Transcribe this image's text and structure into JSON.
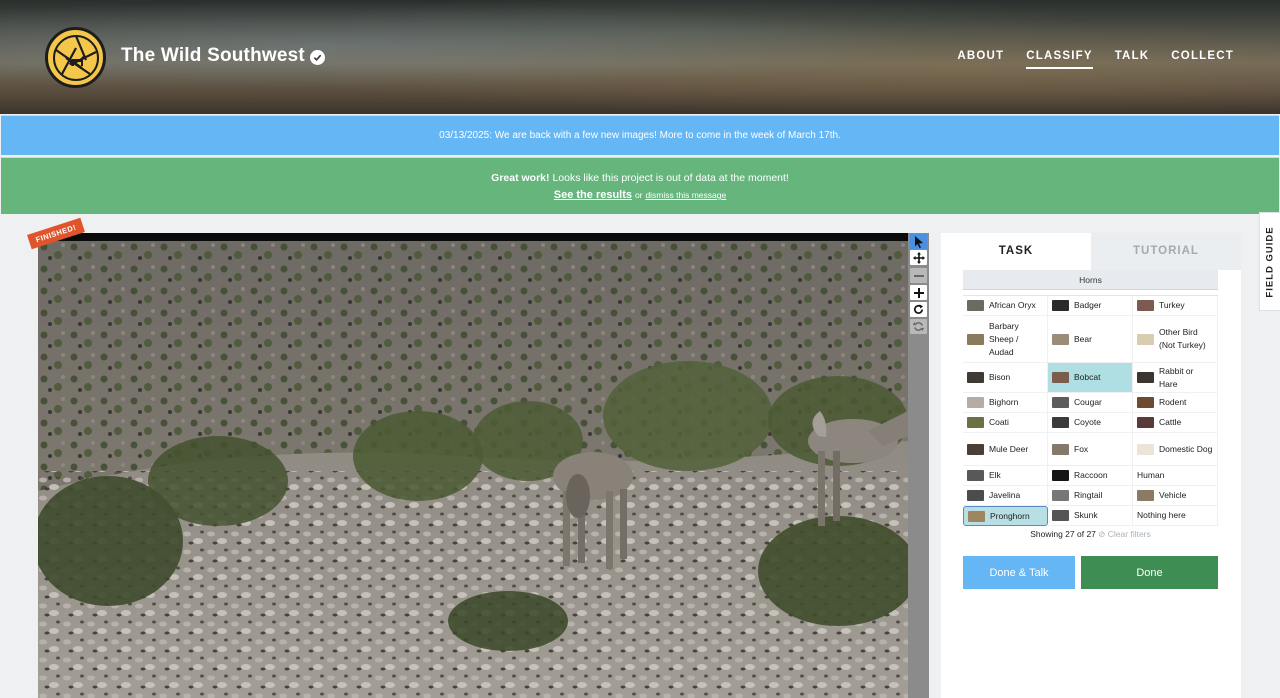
{
  "header": {
    "title": "The Wild Southwest",
    "nav": [
      "ABOUT",
      "CLASSIFY",
      "TALK",
      "COLLECT"
    ],
    "active_nav": "CLASSIFY"
  },
  "banners": {
    "announcement": "03/13/2025: We are back with a few new images! More to come in the week of March 17th.",
    "great_work": "Great work!",
    "out_of_data": "Looks like this project is out of data at the moment!",
    "see_results": "See the results",
    "or": "or",
    "dismiss": "dismiss this message"
  },
  "subject": {
    "status_ribbon": "FINISHED!"
  },
  "toolbar": {
    "icons": [
      "pointer-icon",
      "move-icon",
      "zoom-out-icon",
      "zoom-in-icon",
      "rotate-icon",
      "reset-icon"
    ]
  },
  "panel": {
    "tabs": [
      "TASK",
      "TUTORIAL"
    ],
    "filter_label": "Horns",
    "choices": [
      {
        "label": "African Oryx",
        "thumb": "#6b6a63"
      },
      {
        "label": "Badger",
        "thumb": "#2a2a2a"
      },
      {
        "label": "Turkey",
        "thumb": "#7d5a4f"
      },
      {
        "label": "Barbary Sheep / Audad",
        "thumb": "#8a7a5e"
      },
      {
        "label": "Bear",
        "thumb": "#9a8c78"
      },
      {
        "label": "Other Bird (Not Turkey)",
        "thumb": "#d8cdb0"
      },
      {
        "label": "Bison",
        "thumb": "#3f3a33"
      },
      {
        "label": "Bobcat",
        "thumb": "#7a5d4a"
      },
      {
        "label": "Rabbit or Hare",
        "thumb": "#3a3530"
      },
      {
        "label": "Bighorn",
        "thumb": "#b5aca3"
      },
      {
        "label": "Cougar",
        "thumb": "#5c5c5c"
      },
      {
        "label": "Rodent",
        "thumb": "#6e4a2e"
      },
      {
        "label": "Coati",
        "thumb": "#6d7044"
      },
      {
        "label": "Coyote",
        "thumb": "#3a3a3a"
      },
      {
        "label": "Cattle",
        "thumb": "#5a3a36"
      },
      {
        "label": "Mule Deer",
        "thumb": "#4a3e36"
      },
      {
        "label": "Fox",
        "thumb": "#85796a"
      },
      {
        "label": "Domestic Dog",
        "thumb": "#ece4d6"
      },
      {
        "label": "Elk",
        "thumb": "#585858"
      },
      {
        "label": "Raccoon",
        "thumb": "#151515"
      },
      {
        "label": "Human",
        "thumb": ""
      },
      {
        "label": "Javelina",
        "thumb": "#4c4c4c"
      },
      {
        "label": "Ringtail",
        "thumb": "#777777"
      },
      {
        "label": "Vehicle",
        "thumb": "#8a7a66"
      },
      {
        "label": "Pronghorn",
        "thumb": "#9d8660"
      },
      {
        "label": "Skunk",
        "thumb": "#555555"
      },
      {
        "label": "Nothing here",
        "thumb": ""
      }
    ],
    "selected_choices": [
      "Bobcat",
      "Pronghorn"
    ],
    "showing": "Showing 27 of 27",
    "clear_filters": "Clear filters",
    "done_talk": "Done & Talk",
    "done": "Done"
  },
  "field_guide": "FIELD GUIDE",
  "colors": {
    "blue_banner": "#65b6f5",
    "green_banner": "#65b57d",
    "done_button": "#3e8e53",
    "finished_ribbon": "#e0542c"
  }
}
